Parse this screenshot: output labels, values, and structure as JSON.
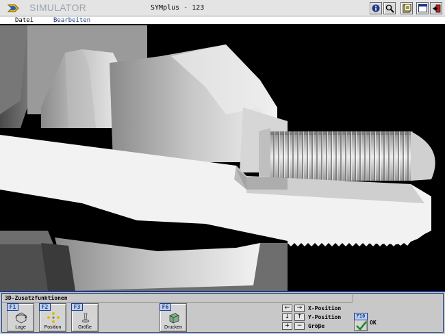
{
  "titlebar": {
    "app_name": "SIMULATOR",
    "version": "SYMplus - 123",
    "buttons": [
      "info-icon",
      "zoom-icon",
      "help-icon",
      "window-icon",
      "exit-icon"
    ]
  },
  "menu": {
    "items": [
      {
        "label": "Datei",
        "active": false
      },
      {
        "label": "Bearbeiten",
        "active": true
      }
    ]
  },
  "panel": {
    "title": "3D-Zusatzfunktionen",
    "buttons": [
      {
        "key": "F1",
        "label": "Lage",
        "icon": "rotate-icon"
      },
      {
        "key": "F2",
        "label": "Position",
        "icon": "move-icon"
      },
      {
        "key": "F3",
        "label": "Größe",
        "icon": "scale-icon"
      },
      {
        "key": "F6",
        "label": "Drucken",
        "icon": "printer-icon"
      }
    ],
    "arrow_controls": [
      {
        "label": "X-Position",
        "left": "←",
        "right": "→"
      },
      {
        "label": "Y-Position",
        "left": "↓",
        "right": "↑"
      },
      {
        "label": "Gröβe",
        "left": "+",
        "right": "−"
      }
    ],
    "ok_key": "F10",
    "ok_label": "OK"
  },
  "colors": {
    "accent": "#1c3a8a",
    "key_bg": "#bcd0ee",
    "panel_bg": "#c8c8c8",
    "viewport_bg": "#000000",
    "menu_active": "#1c3a8a"
  }
}
